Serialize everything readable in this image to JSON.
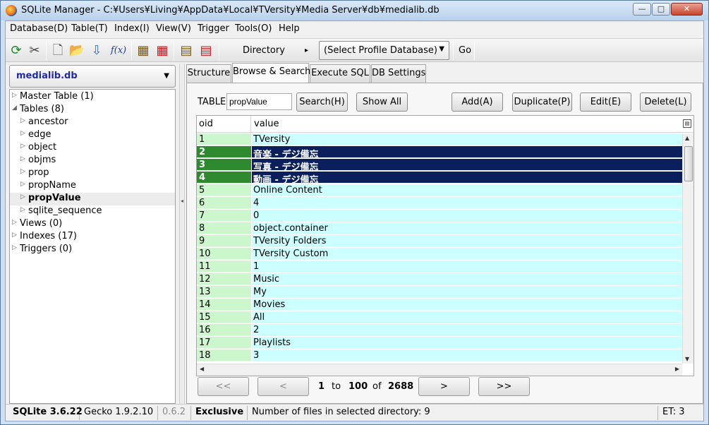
{
  "window": {
    "title": "SQLite Manager - C:¥Users¥Living¥AppData¥Local¥TVersity¥Media Server¥db¥medialib.db",
    "min_label": "—",
    "max_label": "□",
    "close_label": "✕"
  },
  "menu": [
    "Database(D)",
    "Table(T)",
    "Index(I)",
    "View(V)",
    "Trigger",
    "Tools(O)",
    "Help"
  ],
  "toolbar": {
    "icons": [
      "refresh-icon",
      "tools-icon",
      "new-db-icon",
      "open-db-icon",
      "attach-db-icon",
      "function-icon",
      "create-table-icon",
      "drop-table-icon",
      "create-index-icon",
      "drop-index-icon"
    ],
    "fx_label": "f(x)",
    "directory_label": "Directory",
    "directory_arrow": "▸",
    "profile_select": "(Select Profile Database)",
    "go_label": "Go"
  },
  "sidebar": {
    "db_name": "medialib.db",
    "tree": [
      {
        "label": "Master Table (1)",
        "level": 0,
        "expanded": false
      },
      {
        "label": "Tables (8)",
        "level": 0,
        "expanded": true
      },
      {
        "label": "ancestor",
        "level": 1,
        "expanded": false
      },
      {
        "label": "edge",
        "level": 1,
        "expanded": false
      },
      {
        "label": "object",
        "level": 1,
        "expanded": false
      },
      {
        "label": "objms",
        "level": 1,
        "expanded": false
      },
      {
        "label": "prop",
        "level": 1,
        "expanded": false
      },
      {
        "label": "propName",
        "level": 1,
        "expanded": false
      },
      {
        "label": "propValue",
        "level": 1,
        "expanded": false,
        "selected": true
      },
      {
        "label": "sqlite_sequence",
        "level": 1,
        "expanded": false
      },
      {
        "label": "Views (0)",
        "level": 0,
        "expanded": false
      },
      {
        "label": "Indexes (17)",
        "level": 0,
        "expanded": false
      },
      {
        "label": "Triggers (0)",
        "level": 0,
        "expanded": false
      }
    ]
  },
  "tabs": [
    "Structure",
    "Browse & Search",
    "Execute SQL",
    "DB Settings"
  ],
  "active_tab": 1,
  "browse": {
    "table_label": "TABLE",
    "table_value": "propValue",
    "search_button": "Search(H)",
    "show_all_button": "Show All",
    "add_button": "Add(A)",
    "duplicate_button": "Duplicate(P)",
    "edit_button": "Edit(E)",
    "delete_button": "Delete(L)",
    "columns": [
      "oid",
      "value"
    ],
    "rows": [
      {
        "oid": "1",
        "value": "TVersity"
      },
      {
        "oid": "2",
        "value": "音楽 - デジ備忘",
        "selected": true
      },
      {
        "oid": "3",
        "value": "写真 - デジ備忘",
        "selected": true
      },
      {
        "oid": "4",
        "value": "動画 - デジ備忘",
        "selected": true
      },
      {
        "oid": "5",
        "value": "Online Content"
      },
      {
        "oid": "6",
        "value": "4"
      },
      {
        "oid": "7",
        "value": "0"
      },
      {
        "oid": "8",
        "value": "object.container"
      },
      {
        "oid": "9",
        "value": "TVersity Folders"
      },
      {
        "oid": "10",
        "value": "TVersity Custom"
      },
      {
        "oid": "11",
        "value": "1"
      },
      {
        "oid": "12",
        "value": "Music"
      },
      {
        "oid": "13",
        "value": "My"
      },
      {
        "oid": "14",
        "value": "Movies"
      },
      {
        "oid": "15",
        "value": "All"
      },
      {
        "oid": "16",
        "value": "2"
      },
      {
        "oid": "17",
        "value": "Playlists"
      },
      {
        "oid": "18",
        "value": "3"
      }
    ]
  },
  "pager": {
    "first": "<<",
    "prev": "<",
    "from": "1",
    "to_label": "to",
    "to": "100",
    "of_label": "of",
    "total": "2688",
    "next": ">",
    "last": ">>"
  },
  "status": {
    "sqlite": "SQLite 3.6.22",
    "gecko": "Gecko 1.9.2.10",
    "version": "0.6.2",
    "mode": "Exclusive",
    "message": "Number of files in selected directory: 9",
    "et": "ET: 3"
  }
}
